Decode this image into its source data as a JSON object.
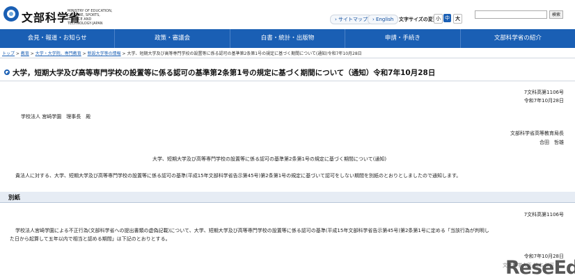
{
  "header": {
    "logo_text": "文部科学省",
    "logo_sub": "MINISTRY OF EDUCATION, CULTURE, SPORTS, SCIENCE AND TECHNOLOGY-JAPAN",
    "sitemap": "› サイトマップ",
    "english": "› English",
    "font_size_label": "文字サイズの変更",
    "font_small": "小",
    "font_medium": "中",
    "font_large": "大",
    "search_button": "検索",
    "search_placeholder": ""
  },
  "nav": {
    "items": [
      "会見・報道・お知らせ",
      "政策・審議会",
      "白書・統計・出版物",
      "申請・手続き",
      "文部科学省の紹介"
    ]
  },
  "breadcrumb": {
    "items": [
      "トップ",
      "教育",
      "大学・大学院、専門教育",
      "新設大学等の情報"
    ],
    "current": "大学、短期大学及び高等専門学校の設置等に係る認可の基準第2条第1号の規定に基づく期間について(通知)令和7年10月28日"
  },
  "title": "大学，短期大学及び高等専門学校の設置等に係る認可の基準第2条第1号の規定に基づく期間について（通知）令和7年10月28日",
  "doc": {
    "number": "7文科高第1106号",
    "date": "令和7年10月28日",
    "addressee": "学校法人 宮崎学園　理事長　殿",
    "sender_org": "文部科学省高等教育局長",
    "sender_name": "合田　哲雄",
    "subject": "大学、短期大学及び高等専門学校の設置等に係る認可の基準第2条第1号の規定に基づく期間について(通知)",
    "body": "貴法人に対する、大学、短期大学及び高等専門学校の設置等に係る認可の基準(平成15年文部科学省告示第45号)第2条第1号の規定に基づいて認可をしない期間を別紙のとおりとしましたので通知します。"
  },
  "annex": {
    "title": "別紙",
    "number": "7文科高第1106号",
    "body_line1": "学校法人宮崎学園による不正行為(文部科学省への提出書類の虚偽記載)について、大学、短期大学及び高等専門学校の設置等に係る認可の基準(平成15年文部科学省告示第45号)第2条第1号に定める「当該行為が判明し",
    "body_line2": "た日から起算して五年以内で相当と認める期間」は下記のとおりとする。",
    "date": "令和7年10月28日",
    "sender_partial": "文部科学大臣 松本 洋平"
  },
  "watermark": "ReseEd",
  "colors": {
    "nav_blue": "#1a5fb4",
    "section_bg": "#e6ecf4"
  }
}
